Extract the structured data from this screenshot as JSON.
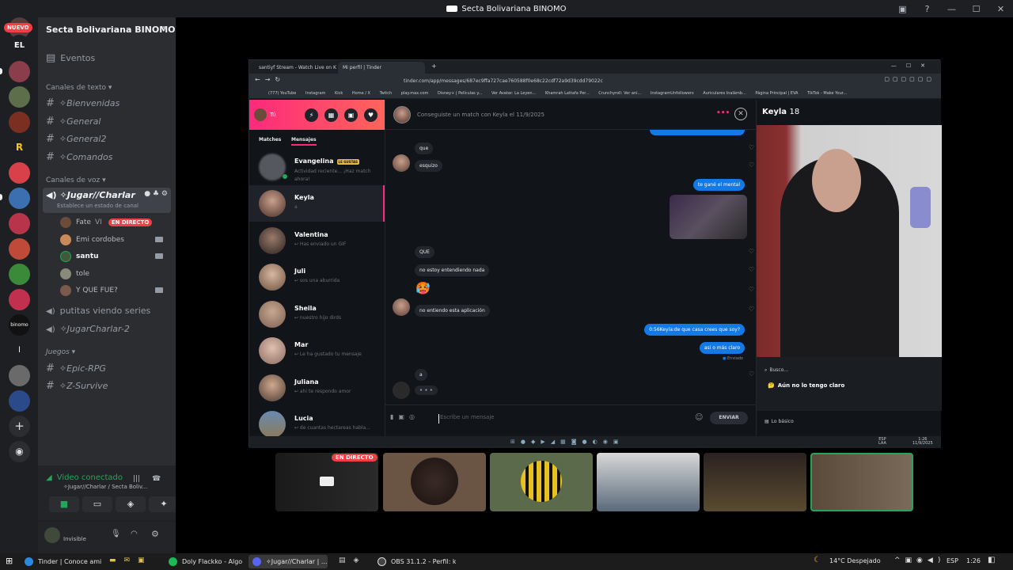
{
  "app": {
    "title": "Secta Bolivariana BINOMO"
  },
  "rail": {
    "nuevo_badge": "NUEVO",
    "el_label": "EL"
  },
  "sidebar": {
    "server_name": "Secta Bolivariana BINOMO",
    "events": "Eventos",
    "text_category": "Canales de texto",
    "text_channels": [
      "✧Bienvenidas",
      "✧General",
      "✧General2",
      "✧Comandos"
    ],
    "voice_category": "Canales de voz",
    "active_voice": {
      "name": "✧Jugar//Charlar",
      "status": "Establece un estado de canal"
    },
    "voice_users": [
      {
        "name": "Fate",
        "extra": "VI",
        "badge": "EN DIRECTO"
      },
      {
        "name": "Emi cordobes"
      },
      {
        "name": "santu"
      },
      {
        "name": "tole"
      },
      {
        "name": "Y QUE FUE?"
      }
    ],
    "voice_channels": [
      "putitas viendo series",
      "✧JugarCharlar-2"
    ],
    "games_category": "Juegos",
    "game_channels": [
      "✧Epic-RPG",
      "✧Z-Survive"
    ]
  },
  "voice_panel": {
    "status": "Video conectado",
    "channel": "✧Jugar//Charlar / Secta Boliv...",
    "user_status": "Invisible"
  },
  "browser": {
    "tabs": [
      "santiyf Stream - Watch Live on Ki",
      "Mi perfil | Tinder"
    ],
    "url": "tinder.com/app/messages/687ec9ffa727cae760588f0e68c22cdf72a9d39cdd79022c",
    "bookmarks": [
      "(777) YouTube",
      "Instagram",
      "Kick",
      "Home / X",
      "Twitch",
      "play.max.com",
      "Disney+ | Películas y...",
      "Ver Avatar: La Leyen...",
      "Khamrah Lattafa Per...",
      "Crunchyroll: Ver ani...",
      "InstagramUnfollowers",
      "Auriculares Inalámb...",
      "Página Principal | EVA",
      "TikTok - Make Your..."
    ]
  },
  "tinder": {
    "me": "Tú",
    "tabs": {
      "matches": "Matches",
      "messages": "Mensajes"
    },
    "conversations": [
      {
        "name": "Evangelina",
        "badge": "LE GUSTAS",
        "preview": "Actividad reciente... ¡Haz match ahora!"
      },
      {
        "name": "Keyla",
        "preview": "a"
      },
      {
        "name": "Valentina",
        "preview": "↩ Has enviado un GIF"
      },
      {
        "name": "Juli",
        "preview": "↩ sos una aburrida"
      },
      {
        "name": "Sheila",
        "preview": "↩ nuestro hijo dirds"
      },
      {
        "name": "Mar",
        "preview": "↩ Le ha gustado tu mensaje"
      },
      {
        "name": "Juliana",
        "preview": "↩ ahi te respondo amor"
      },
      {
        "name": "Lucia",
        "preview": "↩ de cuantas hectareas habla..."
      }
    ],
    "chat_header": "Conseguiste un match con Keyla el 11/9/2025",
    "messages": {
      "m1": "que",
      "m2": "esquizo",
      "m3": "te gané el mental",
      "m4": "QUE",
      "m5": "no estoy entendiendo nada",
      "m6": "🥵",
      "m7": "no entiendo esta aplicación",
      "m8": "0:56Keyla:de que casa crees que soy?",
      "m9": "asi o más claro",
      "sent": "Enviado",
      "m10": "a"
    },
    "composer": {
      "placeholder": "Escribe un mensaje",
      "send": "ENVIAR"
    },
    "profile": {
      "name": "Keyla",
      "age": "18",
      "looking": "Busco...",
      "looking_value": "Aún no lo tengo claro",
      "basics": "Lo básico"
    }
  },
  "inner_taskbar": {
    "lang": "ESP",
    "lang2": "LAA",
    "time": "1:26",
    "date": "11/9/2025"
  },
  "tiles": [
    {
      "badge": "EN DIRECTO"
    }
  ],
  "taskbar": {
    "items": [
      "Tinder | Conoce ami...",
      "Doly Flackko - Algo ...",
      "✧Jugar//Charlar | ...",
      "OBS 31.1.2 - Perfil: ki..."
    ],
    "weather": "14°C Despejado",
    "lang": "ESP",
    "time": "1:26"
  },
  "colors": {
    "accent": "#23a55a",
    "live": "#f23f43",
    "tinder": "#fd297b",
    "bubble": "#1279e6"
  }
}
